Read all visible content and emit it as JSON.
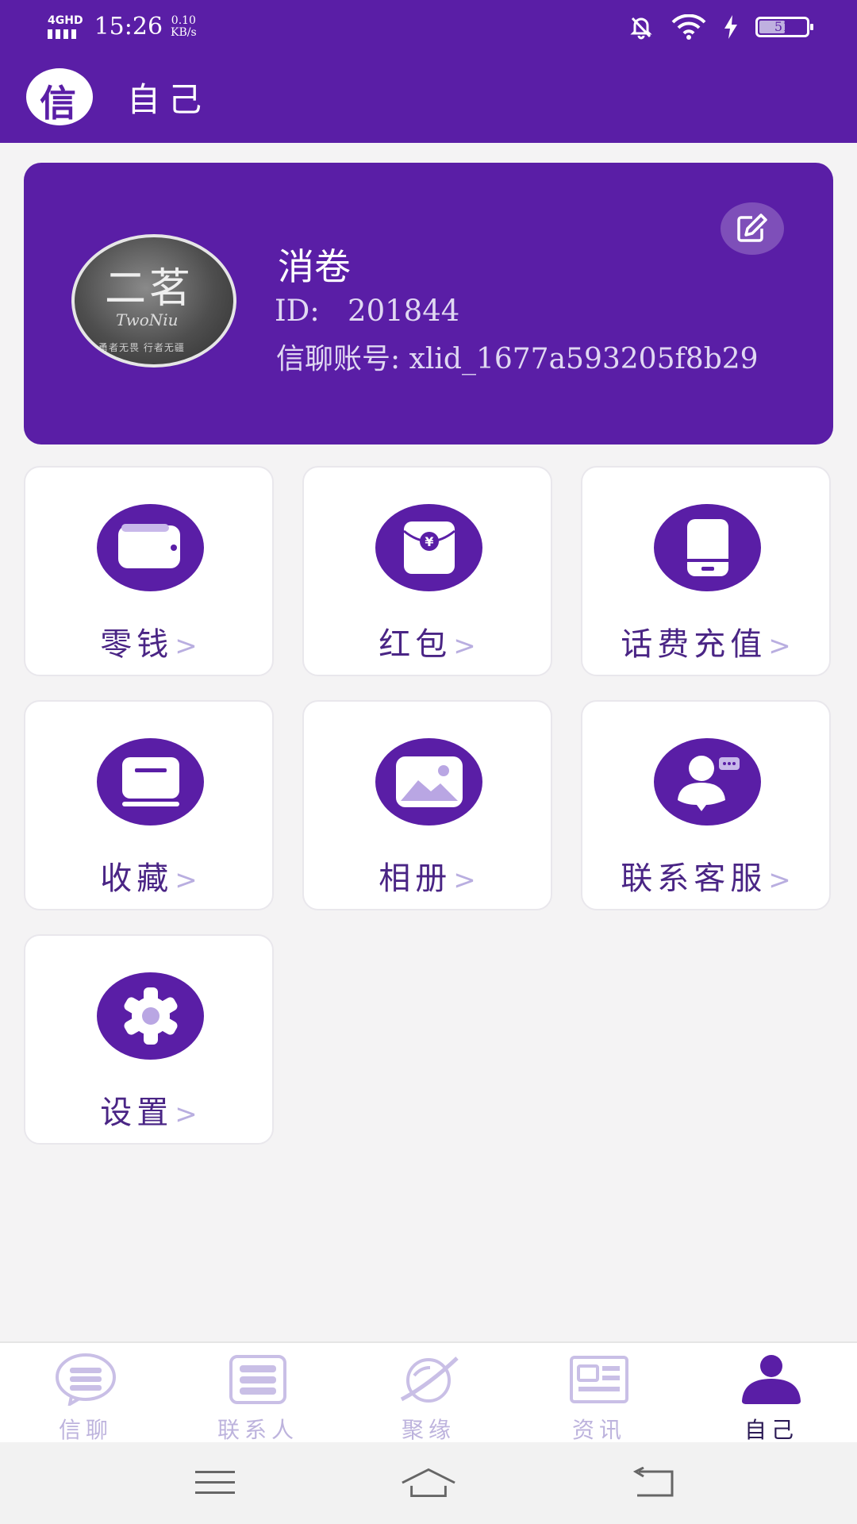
{
  "status_bar": {
    "network": "4GHD",
    "time": "15:26",
    "speed_value": "0.10",
    "speed_unit": "KB/s",
    "battery": "51",
    "battery_level_percent": 51
  },
  "app_bar": {
    "logo_char": "信",
    "title": "自己"
  },
  "profile": {
    "avatar_text": "二茗",
    "avatar_signature": "TwoNiu",
    "avatar_motto": "勇者无畏 行者无疆",
    "name": "消卷",
    "id_label": "ID:",
    "id_value": "201844",
    "account_label": "信聊账号:",
    "account_value": "xlid_1677a593205f8b29",
    "edit_icon": "edit-icon"
  },
  "menu": {
    "items": [
      {
        "label": "零钱",
        "icon": "wallet-icon"
      },
      {
        "label": "红包",
        "icon": "red-packet-icon"
      },
      {
        "label": "话费充值",
        "icon": "phone-recharge-icon"
      },
      {
        "label": "收藏",
        "icon": "bookmark-icon"
      },
      {
        "label": "相册",
        "icon": "album-icon"
      },
      {
        "label": "联系客服",
        "icon": "customer-service-icon"
      },
      {
        "label": "设置",
        "icon": "settings-icon"
      }
    ],
    "chevron": ">"
  },
  "bottom_nav": {
    "items": [
      {
        "label": "信聊",
        "icon": "chat-icon",
        "active": false
      },
      {
        "label": "联系人",
        "icon": "contacts-icon",
        "active": false
      },
      {
        "label": "聚缘",
        "icon": "planet-icon",
        "active": false
      },
      {
        "label": "资讯",
        "icon": "news-icon",
        "active": false
      },
      {
        "label": "自己",
        "icon": "profile-icon",
        "active": true
      }
    ]
  },
  "colors": {
    "primary": "#5a1ea6",
    "tile_label": "#4a2585",
    "inactive_nav": "#bdb3dd",
    "background": "#f4f3f4"
  }
}
